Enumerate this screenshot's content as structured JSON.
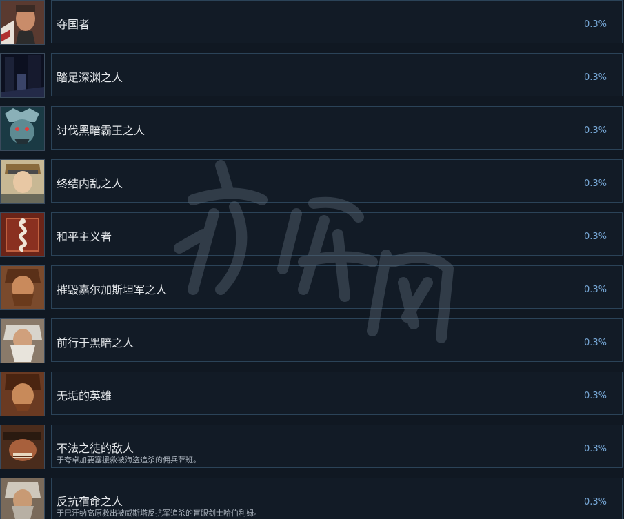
{
  "achievements": [
    {
      "icon": "commander-portrait-icon",
      "title": "夺国者",
      "desc": "",
      "percent": "0.3%"
    },
    {
      "icon": "abyss-corridor-icon",
      "title": "踏足深渊之人",
      "desc": "",
      "percent": "0.3%"
    },
    {
      "icon": "demon-king-portrait-icon",
      "title": "讨伐黑暗霸王之人",
      "desc": "",
      "percent": "0.3%"
    },
    {
      "icon": "young-soldier-portrait-icon",
      "title": "终结内乱之人",
      "desc": "",
      "percent": "0.3%"
    },
    {
      "icon": "serpent-emblem-icon",
      "title": "和平主义者",
      "desc": "",
      "percent": "0.3%"
    },
    {
      "icon": "bearded-warrior-portrait-icon",
      "title": "摧毁嘉尔加斯坦军之人",
      "desc": "",
      "percent": "0.3%"
    },
    {
      "icon": "old-sage-portrait-icon",
      "title": "前行于黑暗之人",
      "desc": "",
      "percent": "0.3%"
    },
    {
      "icon": "rugged-hero-portrait-icon",
      "title": "无垢的英雄",
      "desc": "",
      "percent": "0.3%"
    },
    {
      "icon": "outlaw-portrait-icon",
      "title": "不法之徒的敌人",
      "desc": "于夸卓加要塞援救被海盗追杀的佣兵萨班。",
      "percent": "0.3%"
    },
    {
      "icon": "blind-swordsman-portrait-icon",
      "title": "反抗宿命之人",
      "desc": "于巴汗纳高原救出被威斯塔反抗军追杀的盲眼剑士哈伯利姆。",
      "percent": "0.3%"
    }
  ],
  "watermark": {
    "text": "游侠网"
  }
}
